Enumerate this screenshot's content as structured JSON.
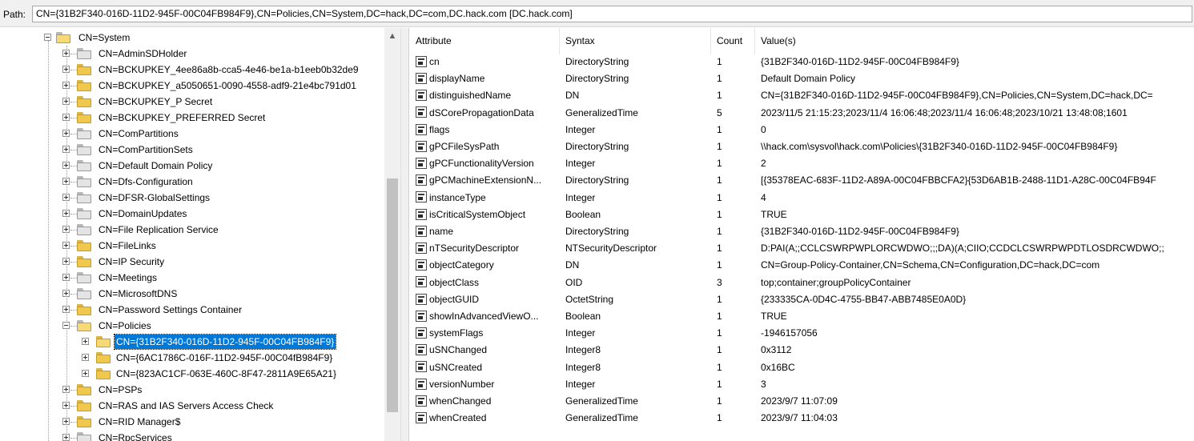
{
  "path": {
    "label": "Path:",
    "value": "CN={31B2F340-016D-11D2-945F-00C04FB984F9},CN=Policies,CN=System,DC=hack,DC=com,DC.hack.com [DC.hack.com]"
  },
  "tree": {
    "parent": "CN=System",
    "children": [
      {
        "label": "CN=AdminSDHolder",
        "icon": "gray-folder-icon"
      },
      {
        "label": "CN=BCKUPKEY_4ee86a8b-cca5-4e46-be1a-b1eeb0b32de9",
        "icon": "folder-icon"
      },
      {
        "label": "CN=BCKUPKEY_a5050651-0090-4558-adf9-21e4bc791d01",
        "icon": "folder-icon"
      },
      {
        "label": "CN=BCKUPKEY_P Secret",
        "icon": "folder-icon"
      },
      {
        "label": "CN=BCKUPKEY_PREFERRED Secret",
        "icon": "folder-icon"
      },
      {
        "label": "CN=ComPartitions",
        "icon": "gray-folder-icon"
      },
      {
        "label": "CN=ComPartitionSets",
        "icon": "gray-folder-icon"
      },
      {
        "label": "CN=Default Domain Policy",
        "icon": "policy-icon"
      },
      {
        "label": "CN=Dfs-Configuration",
        "icon": "gray-folder-icon"
      },
      {
        "label": "CN=DFSR-GlobalSettings",
        "icon": "gray-folder-icon"
      },
      {
        "label": "CN=DomainUpdates",
        "icon": "gray-folder-icon"
      },
      {
        "label": "CN=File Replication Service",
        "icon": "replication-icon"
      },
      {
        "label": "CN=FileLinks",
        "icon": "folder-icon"
      },
      {
        "label": "CN=IP Security",
        "icon": "folder-icon"
      },
      {
        "label": "CN=Meetings",
        "icon": "gray-folder-icon"
      },
      {
        "label": "CN=MicrosoftDNS",
        "icon": "gray-folder-icon"
      },
      {
        "label": "CN=Password Settings Container",
        "icon": "folder-icon"
      },
      {
        "label": "CN=Policies",
        "icon": "gray-folder-icon",
        "expanded": true,
        "children": [
          {
            "label": "CN={31B2F340-016D-11D2-945F-00C04FB984F9}",
            "selected": true
          },
          {
            "label": "CN={6AC1786C-016F-11D2-945F-00C04fB984F9}"
          },
          {
            "label": "CN={823AC1CF-063E-460C-8F47-2811A9E65A21}"
          }
        ]
      },
      {
        "label": "CN=PSPs",
        "icon": "folder-icon"
      },
      {
        "label": "CN=RAS and IAS Servers Access Check",
        "icon": "folder-icon"
      },
      {
        "label": "CN=RID Manager$",
        "icon": "folder-icon"
      },
      {
        "label": "CN=RpcServices",
        "icon": "service-icon"
      }
    ]
  },
  "attributes": {
    "headers": {
      "attribute": "Attribute",
      "syntax": "Syntax",
      "count": "Count",
      "values": "Value(s)"
    },
    "rows": [
      {
        "attribute": "cn",
        "syntax": "DirectoryString",
        "count": "1",
        "value": "{31B2F340-016D-11D2-945F-00C04FB984F9}"
      },
      {
        "attribute": "displayName",
        "syntax": "DirectoryString",
        "count": "1",
        "value": "Default Domain Policy"
      },
      {
        "attribute": "distinguishedName",
        "syntax": "DN",
        "count": "1",
        "value": "CN={31B2F340-016D-11D2-945F-00C04FB984F9},CN=Policies,CN=System,DC=hack,DC="
      },
      {
        "attribute": "dSCorePropagationData",
        "syntax": "GeneralizedTime",
        "count": "5",
        "value": "2023/11/5 21:15:23;2023/11/4 16:06:48;2023/11/4 16:06:48;2023/10/21 13:48:08;1601"
      },
      {
        "attribute": "flags",
        "syntax": "Integer",
        "count": "1",
        "value": "0"
      },
      {
        "attribute": "gPCFileSysPath",
        "syntax": "DirectoryString",
        "count": "1",
        "value": "\\\\hack.com\\sysvol\\hack.com\\Policies\\{31B2F340-016D-11D2-945F-00C04FB984F9}"
      },
      {
        "attribute": "gPCFunctionalityVersion",
        "syntax": "Integer",
        "count": "1",
        "value": "2"
      },
      {
        "attribute": "gPCMachineExtensionN...",
        "syntax": "DirectoryString",
        "count": "1",
        "value": "[{35378EAC-683F-11D2-A89A-00C04FBBCFA2}{53D6AB1B-2488-11D1-A28C-00C04FB94F"
      },
      {
        "attribute": "instanceType",
        "syntax": "Integer",
        "count": "1",
        "value": "4"
      },
      {
        "attribute": "isCriticalSystemObject",
        "syntax": "Boolean",
        "count": "1",
        "value": "TRUE"
      },
      {
        "attribute": "name",
        "syntax": "DirectoryString",
        "count": "1",
        "value": "{31B2F340-016D-11D2-945F-00C04FB984F9}"
      },
      {
        "attribute": "nTSecurityDescriptor",
        "syntax": "NTSecurityDescriptor",
        "count": "1",
        "value": "D:PAI(A;;CCLCSWRPWPLORCWDWO;;;DA)(A;CIIO;CCDCLCSWRPWPDTLOSDRCWDWO;;"
      },
      {
        "attribute": "objectCategory",
        "syntax": "DN",
        "count": "1",
        "value": "CN=Group-Policy-Container,CN=Schema,CN=Configuration,DC=hack,DC=com"
      },
      {
        "attribute": "objectClass",
        "syntax": "OID",
        "count": "3",
        "value": "top;container;groupPolicyContainer"
      },
      {
        "attribute": "objectGUID",
        "syntax": "OctetString",
        "count": "1",
        "value": "{233335CA-0D4C-4755-BB47-ABB7485E0A0D}"
      },
      {
        "attribute": "showInAdvancedViewO...",
        "syntax": "Boolean",
        "count": "1",
        "value": "TRUE"
      },
      {
        "attribute": "systemFlags",
        "syntax": "Integer",
        "count": "1",
        "value": "-1946157056"
      },
      {
        "attribute": "uSNChanged",
        "syntax": "Integer8",
        "count": "1",
        "value": "0x3112"
      },
      {
        "attribute": "uSNCreated",
        "syntax": "Integer8",
        "count": "1",
        "value": "0x16BC"
      },
      {
        "attribute": "versionNumber",
        "syntax": "Integer",
        "count": "1",
        "value": "3"
      },
      {
        "attribute": "whenChanged",
        "syntax": "GeneralizedTime",
        "count": "1",
        "value": "2023/9/7 11:07:09"
      },
      {
        "attribute": "whenCreated",
        "syntax": "GeneralizedTime",
        "count": "1",
        "value": "2023/9/7 11:04:03"
      }
    ]
  },
  "colors": {
    "selection": "#0078d7",
    "folder": "#f0c84d",
    "window_bg": "#f0f0f0"
  }
}
